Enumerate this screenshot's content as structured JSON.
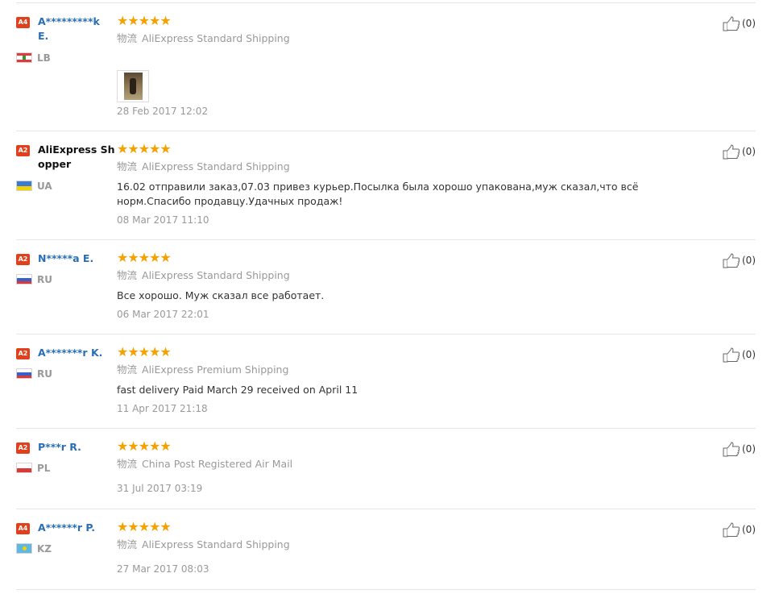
{
  "colors": {
    "badge": "#e2401c",
    "username": "#2a6fb5",
    "star": "#f5a100",
    "muted": "#999999",
    "divider": "#e6e6e6"
  },
  "reviews": [
    {
      "level": "A4",
      "username": "A*********k E.",
      "country": "LB",
      "rating": 5,
      "stars": "★★★★★",
      "ship_label": "物流",
      "shipping": "AliExpress Standard Shipping",
      "text": "",
      "has_image": true,
      "date": "28 Feb 2017 12:02",
      "helpful": "(0)"
    },
    {
      "level": "A2",
      "username": "AliExpress Shopper",
      "country": "UA",
      "rating": 5,
      "stars": "★★★★★",
      "ship_label": "物流",
      "shipping": "AliExpress Standard Shipping",
      "text": "16.02 отправили заказ,07.03 привез курьер.Посылка была хорошо упакована,муж сказал,что всё норм.Спасибо продавцу.Удачных продаж!",
      "has_image": false,
      "date": "08 Mar 2017 11:10",
      "helpful": "(0)"
    },
    {
      "level": "A2",
      "username": "N*****a E.",
      "country": "RU",
      "rating": 5,
      "stars": "★★★★★",
      "ship_label": "物流",
      "shipping": "AliExpress Standard Shipping",
      "text": "Все хорошо. Муж сказал все работает.",
      "has_image": false,
      "date": "06 Mar 2017 22:01",
      "helpful": "(0)"
    },
    {
      "level": "A2",
      "username": "A*******r K.",
      "country": "RU",
      "rating": 5,
      "stars": "★★★★★",
      "ship_label": "物流",
      "shipping": "AliExpress Premium Shipping",
      "text": "fast delivery Paid March 29 received on April 11",
      "has_image": false,
      "date": "11 Apr 2017 21:18",
      "helpful": "(0)"
    },
    {
      "level": "A2",
      "username": "P***r R.",
      "country": "PL",
      "rating": 5,
      "stars": "★★★★★",
      "ship_label": "物流",
      "shipping": "China Post Registered Air Mail",
      "text": "",
      "has_image": false,
      "date": "31 Jul 2017 03:19",
      "helpful": "(0)"
    },
    {
      "level": "A4",
      "username": "A******r P.",
      "country": "KZ",
      "rating": 5,
      "stars": "★★★★★",
      "ship_label": "物流",
      "shipping": "AliExpress Standard Shipping",
      "text": "",
      "has_image": false,
      "date": "27 Mar 2017 08:03",
      "helpful": "(0)"
    }
  ]
}
